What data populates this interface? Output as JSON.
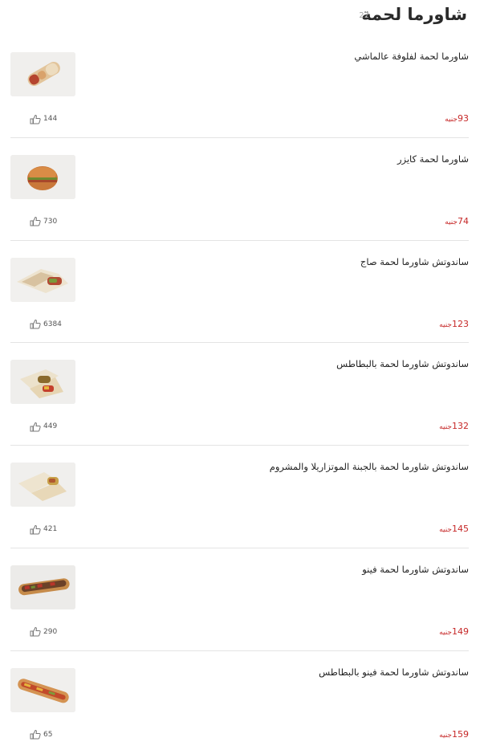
{
  "header": {
    "title": "شاورما لحمة",
    "count": "22"
  },
  "colors": {
    "price": "#c62828",
    "divider": "#e4e4e4",
    "title": "#2a2a2a"
  },
  "items": [
    {
      "name": "شاورما لحمة لفلوفة عالماشي",
      "price": "93",
      "currency": "جنيه",
      "likes": "144",
      "image": "wrap-roll"
    },
    {
      "name": "شاورما لحمة كايزر",
      "price": "74",
      "currency": "جنيه",
      "likes": "730",
      "image": "kaiser-bun"
    },
    {
      "name": "ساندوتش شاورما لحمة صاج",
      "price": "123",
      "currency": "جنيه",
      "likes": "6384",
      "image": "saj-wrap"
    },
    {
      "name": "ساندوتش شاورما لحمة بالبطاطس",
      "price": "132",
      "currency": "جنيه",
      "likes": "449",
      "image": "wrap-fries"
    },
    {
      "name": "ساندوتش شاورما لحمة بالجبنة الموتزاريلا والمشروم",
      "price": "145",
      "currency": "جنيه",
      "likes": "421",
      "image": "wrap-cheese"
    },
    {
      "name": "ساندوتش شاورما لحمة فينو",
      "price": "149",
      "currency": "جنيه",
      "likes": "290",
      "image": "fino-open"
    },
    {
      "name": "ساندوتش شاورما لحمة فينو بالبطاطس",
      "price": "159",
      "currency": "جنيه",
      "likes": "65",
      "image": "fino-fries"
    }
  ]
}
